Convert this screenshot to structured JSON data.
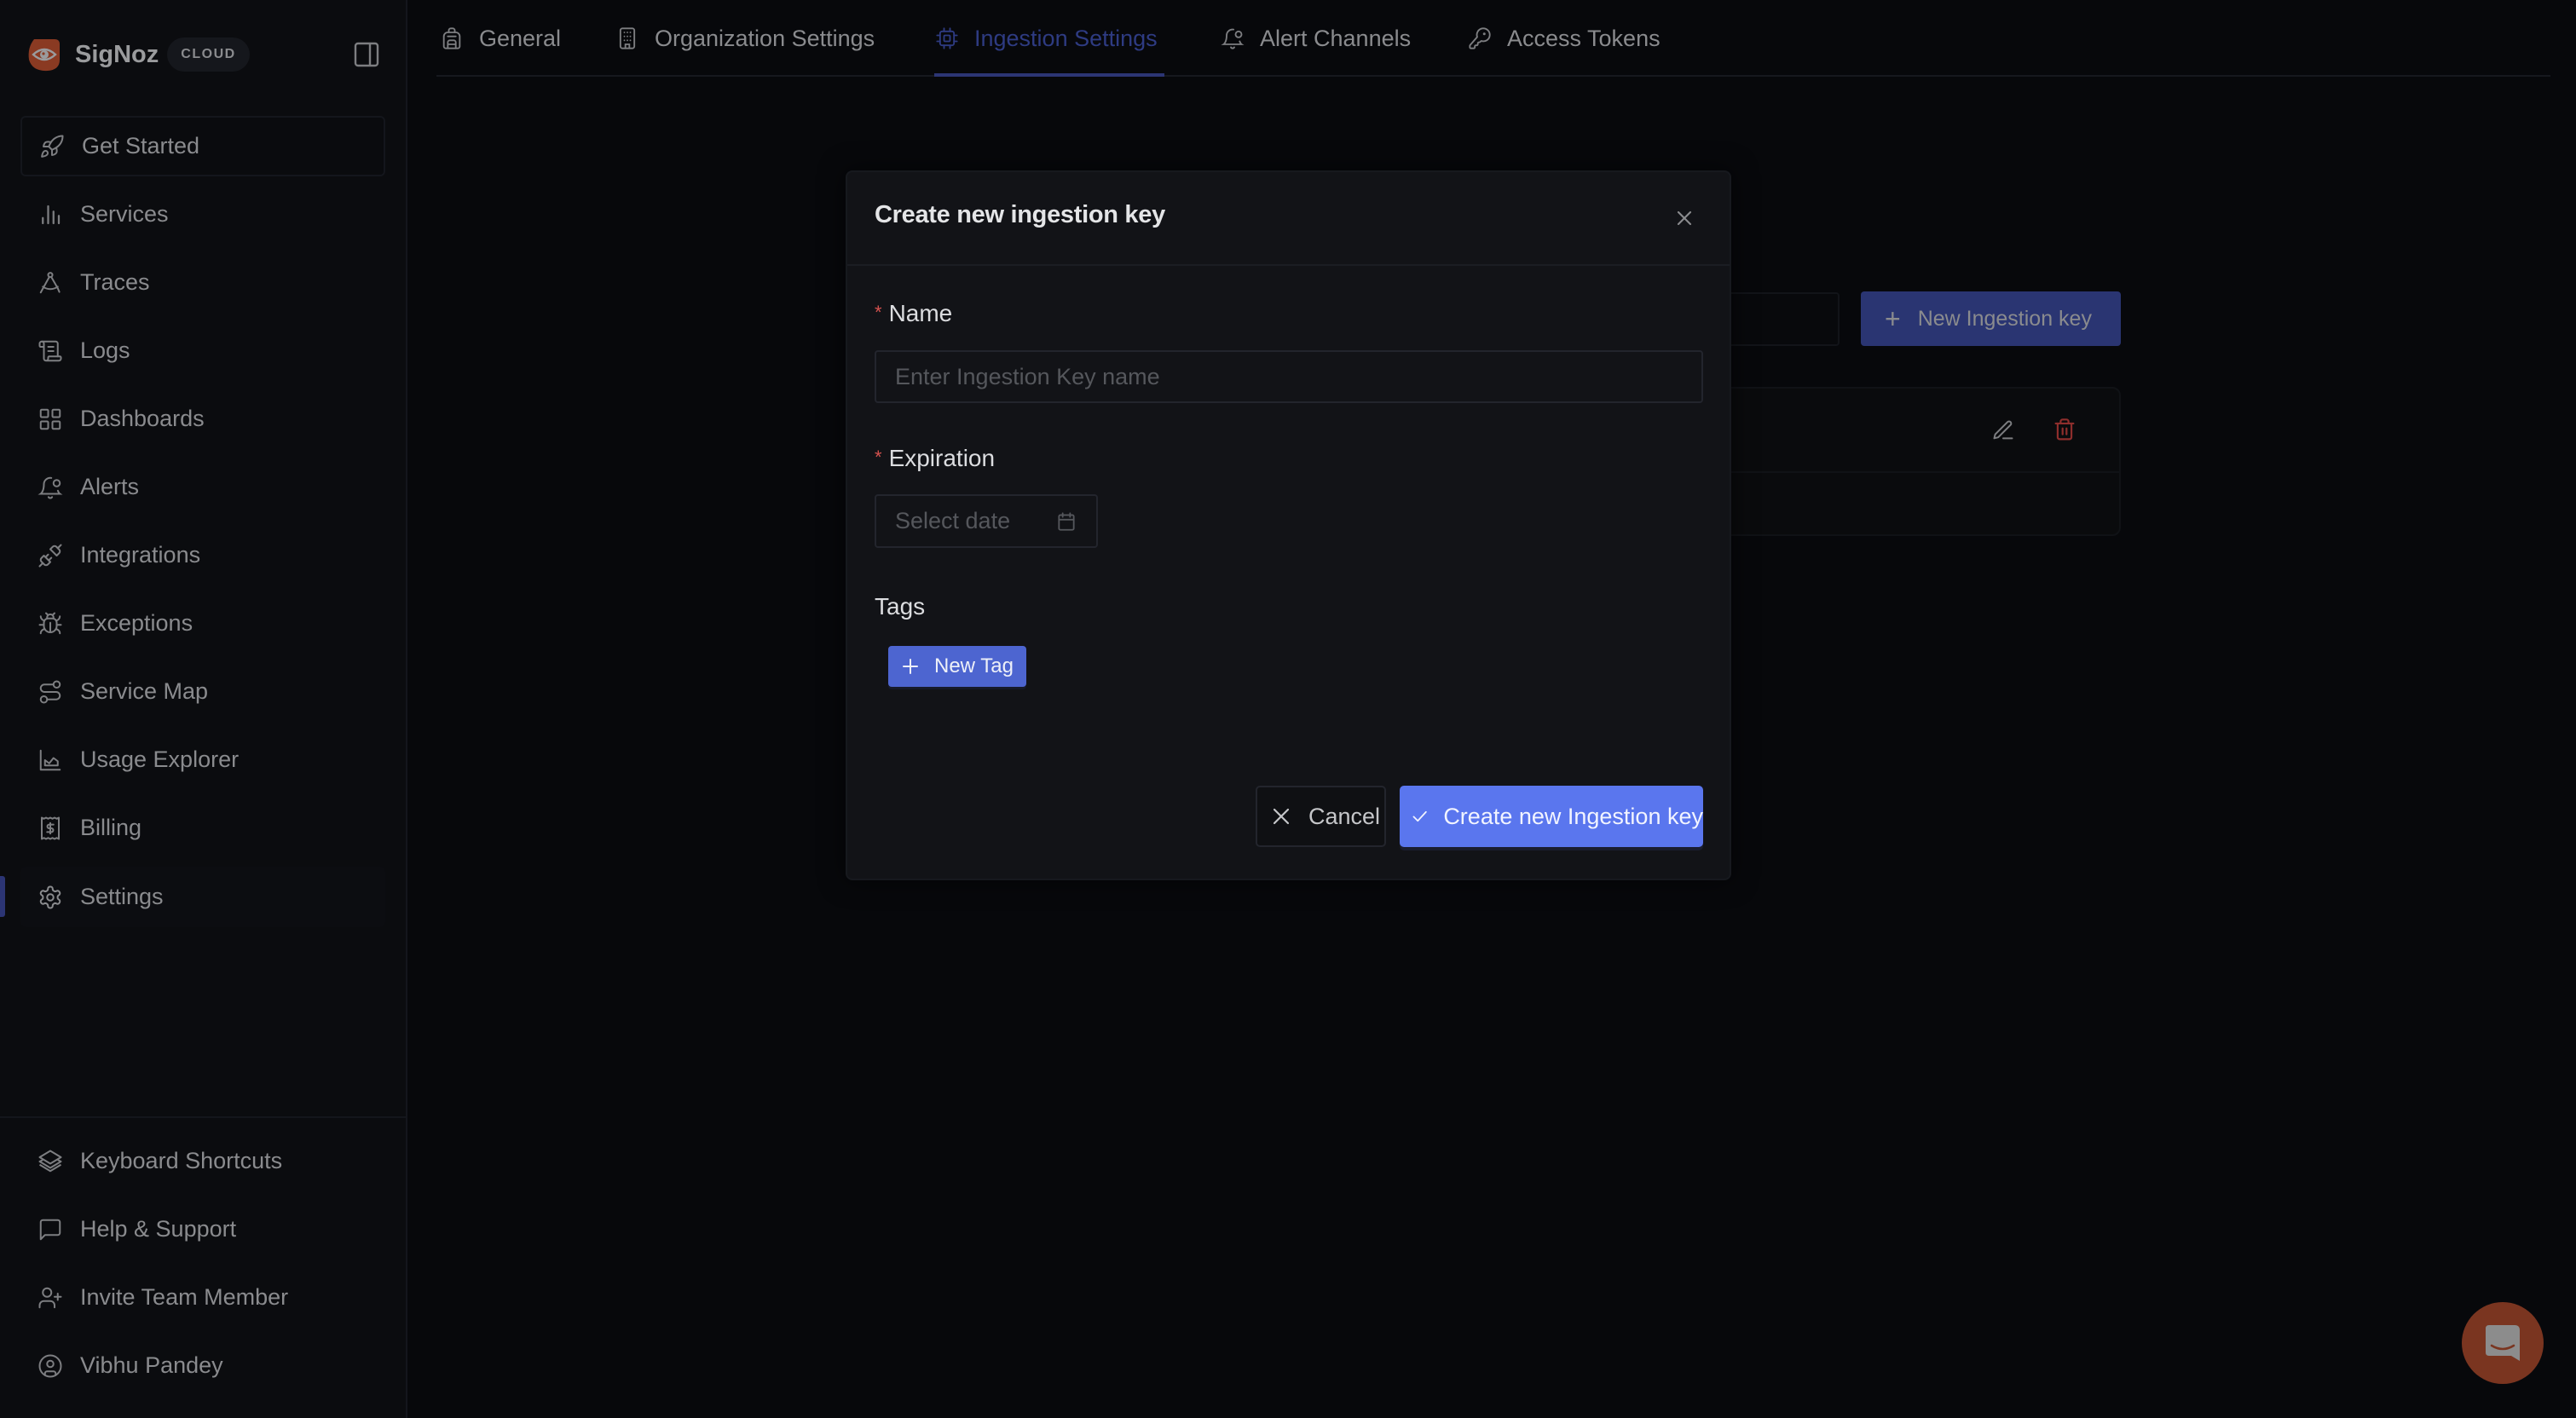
{
  "brand": {
    "name": "SigNoz",
    "badge": "CLOUD",
    "logo_color": "#8a3a22"
  },
  "sidebar": {
    "items": [
      {
        "label": "Get Started",
        "icon": "rocket-icon"
      },
      {
        "label": "Services",
        "icon": "bar-chart-icon"
      },
      {
        "label": "Traces",
        "icon": "compass-draft-icon"
      },
      {
        "label": "Logs",
        "icon": "scroll-icon"
      },
      {
        "label": "Dashboards",
        "icon": "grid-icon"
      },
      {
        "label": "Alerts",
        "icon": "bell-dot-icon"
      },
      {
        "label": "Integrations",
        "icon": "plug-icon"
      },
      {
        "label": "Exceptions",
        "icon": "bug-icon"
      },
      {
        "label": "Service Map",
        "icon": "route-icon"
      },
      {
        "label": "Usage Explorer",
        "icon": "area-chart-icon"
      },
      {
        "label": "Billing",
        "icon": "receipt-icon"
      },
      {
        "label": "Settings",
        "icon": "gear-icon",
        "active": true
      }
    ],
    "footer_items": [
      {
        "label": "Keyboard Shortcuts",
        "icon": "layers-icon"
      },
      {
        "label": "Help & Support",
        "icon": "message-square-icon"
      },
      {
        "label": "Invite Team Member",
        "icon": "user-plus-icon"
      },
      {
        "label": "Vibhu Pandey",
        "icon": "user-circle-icon"
      }
    ]
  },
  "tabs": [
    {
      "label": "General",
      "icon": "backpack-icon"
    },
    {
      "label": "Organization Settings",
      "icon": "building-icon"
    },
    {
      "label": "Ingestion Settings",
      "icon": "cpu-icon",
      "active": true
    },
    {
      "label": "Alert Channels",
      "icon": "bell-dot-icon"
    },
    {
      "label": "Access Tokens",
      "icon": "key-icon"
    }
  ],
  "background": {
    "new_key_button": "New Ingestion key",
    "search_value": ""
  },
  "modal": {
    "title": "Create new ingestion key",
    "name": {
      "label": "Name",
      "required": true,
      "placeholder": "Enter Ingestion Key name",
      "value": ""
    },
    "expiration": {
      "label": "Expiration",
      "required": true,
      "placeholder": "Select date",
      "value": ""
    },
    "tags": {
      "label": "Tags",
      "new_tag_button": "New Tag"
    },
    "cancel_button": "Cancel",
    "submit_button": "Create new Ingestion key"
  },
  "colors": {
    "accent": "#5a76ee",
    "accent_dim": "#2a3572",
    "danger": "#d5524f",
    "chat_launcher": "#7a3520"
  }
}
